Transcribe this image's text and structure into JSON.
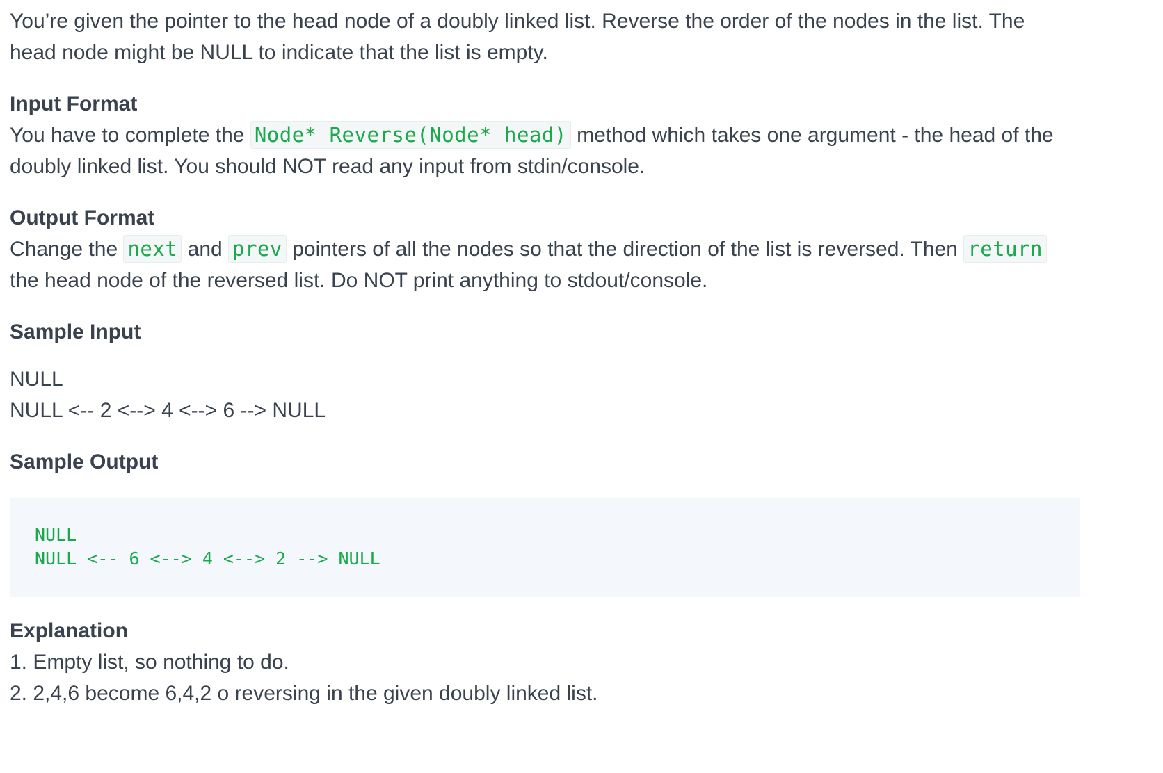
{
  "intro": {
    "line1": "You’re given the pointer to the head node of a doubly linked list. Reverse the order of the nodes in the list. The",
    "line2": "head node might be NULL to indicate that the list is empty."
  },
  "input_format": {
    "heading": "Input Format",
    "text_before": "You have to complete the ",
    "code": "Node* Reverse(Node* head)",
    "text_after": " method which takes one argument - the head of the",
    "line2": "doubly linked list. You should NOT read any input from stdin/console."
  },
  "output_format": {
    "heading": "Output Format",
    "t1": "Change the ",
    "code1": "next",
    "t2": " and ",
    "code2": "prev",
    "t3": " pointers of all the nodes so that the direction of the list is reversed. Then ",
    "code3": "return",
    "line2": "the head node of the reversed list. Do NOT print anything to stdout/console."
  },
  "sample_input": {
    "heading": "Sample Input",
    "lines": [
      "NULL",
      "NULL <-- 2 <--> 4 <--> 6 --> NULL"
    ]
  },
  "sample_output": {
    "heading": "Sample Output",
    "lines": [
      "NULL",
      "NULL <-- 6 <--> 4 <--> 2 --> NULL"
    ]
  },
  "explanation": {
    "heading": "Explanation",
    "items": [
      "1. Empty list, so nothing to do.",
      "2. 2,4,6 become 6,4,2 o reversing in the given doubly linked list."
    ]
  },
  "colors": {
    "text": "#39424e",
    "code_green": "#1ba94c",
    "code_bg": "#f4f8fd"
  }
}
